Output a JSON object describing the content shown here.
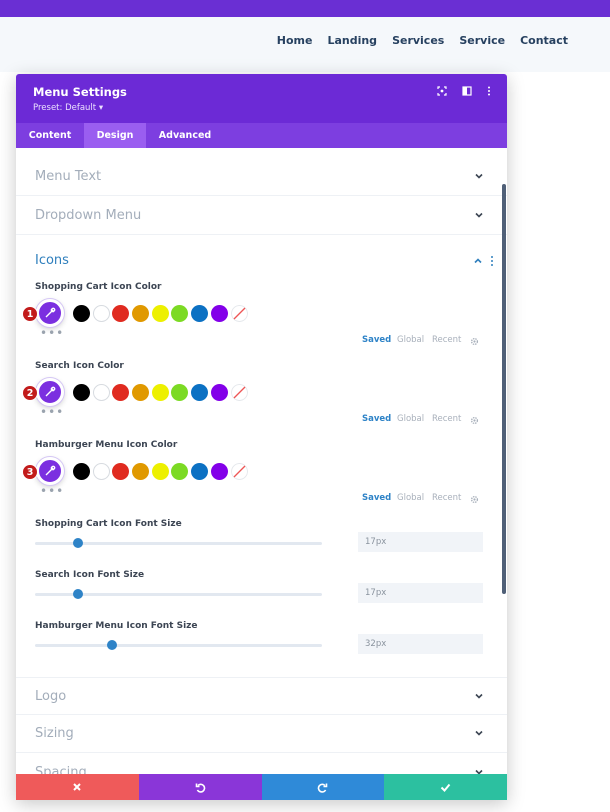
{
  "nav": {
    "items": [
      "Home",
      "Landing",
      "Services",
      "Service",
      "Contact"
    ]
  },
  "panel": {
    "title": "Menu Settings",
    "preset": "Preset: Default ▾",
    "tabs": [
      "Content",
      "Design",
      "Advanced"
    ],
    "active_tab": "Design"
  },
  "sections": {
    "menu_text": "Menu Text",
    "dropdown_menu": "Dropdown Menu",
    "icons": "Icons",
    "logo": "Logo",
    "sizing": "Sizing",
    "spacing": "Spacing"
  },
  "color_fields": [
    {
      "label": "Shopping Cart Icon Color",
      "badge": "1"
    },
    {
      "label": "Search Icon Color",
      "badge": "2"
    },
    {
      "label": "Hamburger Menu Icon Color",
      "badge": "3"
    }
  ],
  "palette": {
    "swatches": [
      "#000000",
      "#ffffff",
      "#e02b20",
      "#e09900",
      "#edf000",
      "#7cda24",
      "#0c71c3",
      "#8300e9"
    ],
    "tabs": [
      "Saved",
      "Global",
      "Recent"
    ],
    "more": "•••"
  },
  "size_fields": [
    {
      "label": "Shopping Cart Icon Font Size",
      "value": "17px",
      "fraction": 0.15
    },
    {
      "label": "Search Icon Font Size",
      "value": "17px",
      "fraction": 0.15
    },
    {
      "label": "Hamburger Menu Icon Font Size",
      "value": "32px",
      "fraction": 0.27
    }
  ],
  "colors": {
    "header_purple": "#6c2ad6",
    "tab_bar": "#7d3ee0",
    "accent_blue": "#2e83c7",
    "badge_red": "#c21b1b",
    "discard": "#ef5a5a",
    "undo": "#8a36d8",
    "redo": "#2f8ad8",
    "save": "#2cc0a0"
  },
  "icons": {
    "panel_head": [
      "focus-icon",
      "sidebar-toggle-icon",
      "more-vertical-icon"
    ],
    "footer": [
      "close-icon",
      "undo-icon",
      "redo-icon",
      "check-icon"
    ]
  }
}
